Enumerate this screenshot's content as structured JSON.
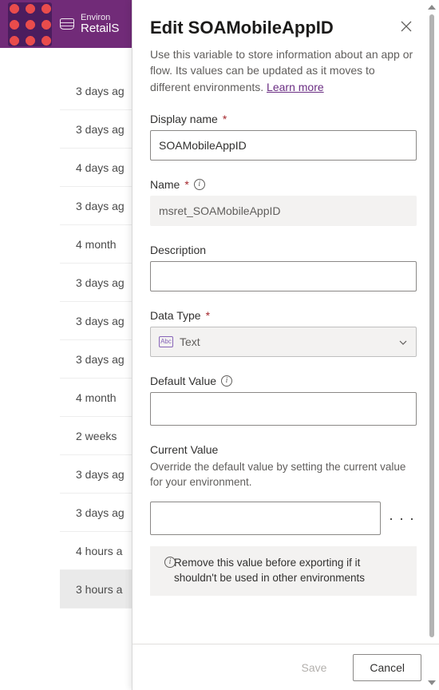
{
  "header": {
    "env_label": "Environ",
    "env_name": "RetailS"
  },
  "list": {
    "rows": [
      "3 days ag",
      "3 days ag",
      "4 days ag",
      "3 days ag",
      "4 month",
      "3 days ag",
      "3 days ag",
      "3 days ag",
      "4 month",
      "2 weeks",
      "3 days ag",
      "3 days ag",
      "4 hours a",
      "3 hours a"
    ]
  },
  "panel": {
    "title": "Edit SOAMobileAppID",
    "description": "Use this variable to store information about an app or flow. Its values can be updated as it moves to different environments.",
    "learn_more": "Learn more",
    "display_name": {
      "label": "Display name",
      "value": "SOAMobileAppID"
    },
    "name": {
      "label": "Name",
      "value": "msret_SOAMobileAppID"
    },
    "description_field": {
      "label": "Description",
      "value": ""
    },
    "data_type": {
      "label": "Data Type",
      "value": "Text",
      "icon_text": "Abc"
    },
    "default_value": {
      "label": "Default Value",
      "value": ""
    },
    "current_value": {
      "label": "Current Value",
      "help": "Override the default value by setting the current value for your environment.",
      "value": ""
    },
    "note": "Remove this value before exporting if it shouldn't be used in other environments",
    "footer": {
      "save": "Save",
      "cancel": "Cancel"
    }
  }
}
